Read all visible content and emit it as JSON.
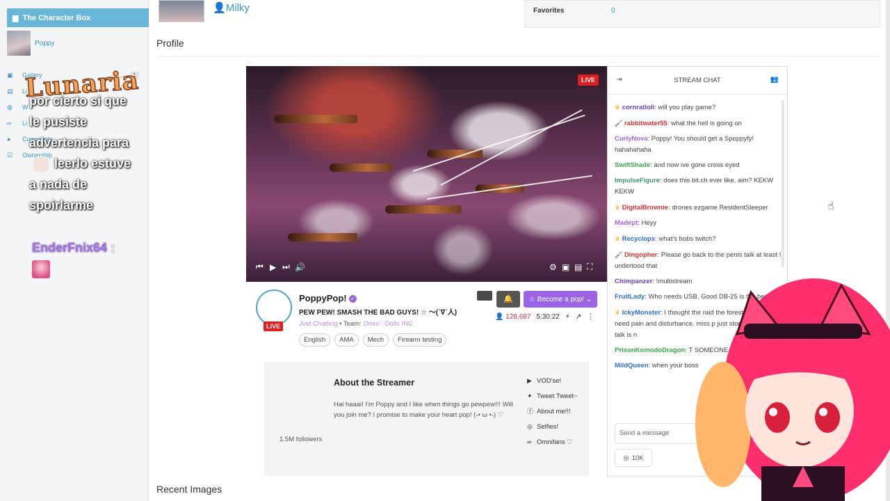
{
  "sidebar": {
    "header": "The Character Box",
    "character": "Poppy",
    "nav": [
      {
        "label": "Gallery",
        "badge": "1"
      },
      {
        "label": "Li"
      },
      {
        "label": "W"
      },
      {
        "label": "Li"
      },
      {
        "label": "Comments"
      },
      {
        "label": "Ownership"
      }
    ]
  },
  "overlay": {
    "logo": "Lunaria",
    "message_line1": "por cierto si que",
    "message_line2": "le pusiste",
    "message_line3": "advertencia para",
    "message_line4": "leerlo estuve",
    "message_line5": "a nada de",
    "message_line6": "spoirlarme",
    "username": "EnderFnix64",
    "colon": ":"
  },
  "header": {
    "username": "Milky",
    "favorites_label": "Favorites",
    "favorites_value": "0"
  },
  "profile_title": "Profile",
  "video": {
    "live": "LIVE"
  },
  "stream": {
    "live": "LIVE",
    "name": "PoppyPop!",
    "title": "PEW PEW! SMASH THE BAD GUYS! ☆ 〜(ˊ∇ˋ人)",
    "category": "Just Chatting",
    "team_prefix": " • Team: ",
    "team": "Omni♡Dolls INC.",
    "tags": [
      "English",
      "AMA",
      "Mech",
      "Firearm testing"
    ],
    "pop_button": "Become a pop!",
    "viewers": "128,687",
    "duration": "5:30:22"
  },
  "about": {
    "heading": "About the Streamer",
    "text": "Hai haaai! I'm Poppy and I like when things go pewpew!!! Will you join me? I promise to make your heart pop! (˶• ω •˶) ♡",
    "followers": "1.5M followers",
    "links": [
      "VOD'se!",
      "Tweet Tweet~",
      "About me!!!",
      "Selfies!",
      "Omnifans ♡"
    ]
  },
  "recent_images": "Recent Images",
  "chat": {
    "title": "STREAM CHAT",
    "input_placeholder": "Send a message",
    "points": "10K",
    "messages": [
      {
        "user": "cornratloli",
        "color": "#6a3fc9",
        "badge": "crown",
        "text": ": will you play game?"
      },
      {
        "user": "rabbitwater55",
        "color": "#e03030",
        "badge": "brush",
        "text": ": what the hell is going on"
      },
      {
        "user": "CurlyNova",
        "color": "#a066e0",
        "badge": "",
        "text": ": Poppy! You should get a Spoppyfy! hahahahaha"
      },
      {
        "user": "SwiftShade",
        "color": "#3aa84a",
        "badge": "",
        "text": ": and now ive gone cross eyed"
      },
      {
        "user": "ImpulseFigure",
        "color": "#3a9a6a",
        "badge": "",
        "text": ": does this bit.ch ever like, aim? KEKW KEKW"
      },
      {
        "user": "DigitalBrownie",
        "color": "#e03030",
        "badge": "crown",
        "text": ": drones ezgame ResidentSleeper"
      },
      {
        "user": "Madept",
        "color": "#a066e0",
        "badge": "",
        "text": ": Heyy"
      },
      {
        "user": "Recyclops",
        "color": "#2a6fd9",
        "badge": "crown",
        "text": ": what's bobs twitch?"
      },
      {
        "user": "Dingopher",
        "color": "#e03030",
        "badge": "brush",
        "text": ": Please go back to the penis talk at least I undertood that"
      },
      {
        "user": "Chimpanzer",
        "color": "#6a3fc9",
        "badge": "",
        "text": ": !multistream"
      },
      {
        "user": "FruitLady",
        "color": "#2a6fd9",
        "badge": "",
        "text": ": Who needs USB. Good DB-25 is the best xD"
      },
      {
        "user": "IckyMonster",
        "color": "#2a6fd9",
        "badge": "crown",
        "text": ": I thought the raid the forest...I did not need pain and disturbance. miss p just stop. this tech talk is n"
      },
      {
        "user": "PrisonKomodoDragon",
        "color": "#3aa84a",
        "badge": "",
        "text": ": T SOMEONE ADD TO THE CO"
      },
      {
        "user": "MildQueen",
        "color": "#2a6fd9",
        "badge": "",
        "text": ": when your boss"
      }
    ]
  }
}
